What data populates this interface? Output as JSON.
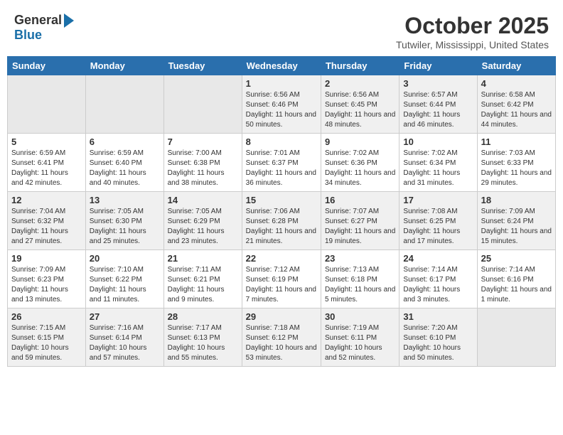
{
  "header": {
    "logo_general": "General",
    "logo_blue": "Blue",
    "month": "October 2025",
    "location": "Tutwiler, Mississippi, United States"
  },
  "days_of_week": [
    "Sunday",
    "Monday",
    "Tuesday",
    "Wednesday",
    "Thursday",
    "Friday",
    "Saturday"
  ],
  "weeks": [
    [
      {
        "day": "",
        "info": ""
      },
      {
        "day": "",
        "info": ""
      },
      {
        "day": "",
        "info": ""
      },
      {
        "day": "1",
        "info": "Sunrise: 6:56 AM\nSunset: 6:46 PM\nDaylight: 11 hours and 50 minutes."
      },
      {
        "day": "2",
        "info": "Sunrise: 6:56 AM\nSunset: 6:45 PM\nDaylight: 11 hours and 48 minutes."
      },
      {
        "day": "3",
        "info": "Sunrise: 6:57 AM\nSunset: 6:44 PM\nDaylight: 11 hours and 46 minutes."
      },
      {
        "day": "4",
        "info": "Sunrise: 6:58 AM\nSunset: 6:42 PM\nDaylight: 11 hours and 44 minutes."
      }
    ],
    [
      {
        "day": "5",
        "info": "Sunrise: 6:59 AM\nSunset: 6:41 PM\nDaylight: 11 hours and 42 minutes."
      },
      {
        "day": "6",
        "info": "Sunrise: 6:59 AM\nSunset: 6:40 PM\nDaylight: 11 hours and 40 minutes."
      },
      {
        "day": "7",
        "info": "Sunrise: 7:00 AM\nSunset: 6:38 PM\nDaylight: 11 hours and 38 minutes."
      },
      {
        "day": "8",
        "info": "Sunrise: 7:01 AM\nSunset: 6:37 PM\nDaylight: 11 hours and 36 minutes."
      },
      {
        "day": "9",
        "info": "Sunrise: 7:02 AM\nSunset: 6:36 PM\nDaylight: 11 hours and 34 minutes."
      },
      {
        "day": "10",
        "info": "Sunrise: 7:02 AM\nSunset: 6:34 PM\nDaylight: 11 hours and 31 minutes."
      },
      {
        "day": "11",
        "info": "Sunrise: 7:03 AM\nSunset: 6:33 PM\nDaylight: 11 hours and 29 minutes."
      }
    ],
    [
      {
        "day": "12",
        "info": "Sunrise: 7:04 AM\nSunset: 6:32 PM\nDaylight: 11 hours and 27 minutes."
      },
      {
        "day": "13",
        "info": "Sunrise: 7:05 AM\nSunset: 6:30 PM\nDaylight: 11 hours and 25 minutes."
      },
      {
        "day": "14",
        "info": "Sunrise: 7:05 AM\nSunset: 6:29 PM\nDaylight: 11 hours and 23 minutes."
      },
      {
        "day": "15",
        "info": "Sunrise: 7:06 AM\nSunset: 6:28 PM\nDaylight: 11 hours and 21 minutes."
      },
      {
        "day": "16",
        "info": "Sunrise: 7:07 AM\nSunset: 6:27 PM\nDaylight: 11 hours and 19 minutes."
      },
      {
        "day": "17",
        "info": "Sunrise: 7:08 AM\nSunset: 6:25 PM\nDaylight: 11 hours and 17 minutes."
      },
      {
        "day": "18",
        "info": "Sunrise: 7:09 AM\nSunset: 6:24 PM\nDaylight: 11 hours and 15 minutes."
      }
    ],
    [
      {
        "day": "19",
        "info": "Sunrise: 7:09 AM\nSunset: 6:23 PM\nDaylight: 11 hours and 13 minutes."
      },
      {
        "day": "20",
        "info": "Sunrise: 7:10 AM\nSunset: 6:22 PM\nDaylight: 11 hours and 11 minutes."
      },
      {
        "day": "21",
        "info": "Sunrise: 7:11 AM\nSunset: 6:21 PM\nDaylight: 11 hours and 9 minutes."
      },
      {
        "day": "22",
        "info": "Sunrise: 7:12 AM\nSunset: 6:19 PM\nDaylight: 11 hours and 7 minutes."
      },
      {
        "day": "23",
        "info": "Sunrise: 7:13 AM\nSunset: 6:18 PM\nDaylight: 11 hours and 5 minutes."
      },
      {
        "day": "24",
        "info": "Sunrise: 7:14 AM\nSunset: 6:17 PM\nDaylight: 11 hours and 3 minutes."
      },
      {
        "day": "25",
        "info": "Sunrise: 7:14 AM\nSunset: 6:16 PM\nDaylight: 11 hours and 1 minute."
      }
    ],
    [
      {
        "day": "26",
        "info": "Sunrise: 7:15 AM\nSunset: 6:15 PM\nDaylight: 10 hours and 59 minutes."
      },
      {
        "day": "27",
        "info": "Sunrise: 7:16 AM\nSunset: 6:14 PM\nDaylight: 10 hours and 57 minutes."
      },
      {
        "day": "28",
        "info": "Sunrise: 7:17 AM\nSunset: 6:13 PM\nDaylight: 10 hours and 55 minutes."
      },
      {
        "day": "29",
        "info": "Sunrise: 7:18 AM\nSunset: 6:12 PM\nDaylight: 10 hours and 53 minutes."
      },
      {
        "day": "30",
        "info": "Sunrise: 7:19 AM\nSunset: 6:11 PM\nDaylight: 10 hours and 52 minutes."
      },
      {
        "day": "31",
        "info": "Sunrise: 7:20 AM\nSunset: 6:10 PM\nDaylight: 10 hours and 50 minutes."
      },
      {
        "day": "",
        "info": ""
      }
    ]
  ]
}
